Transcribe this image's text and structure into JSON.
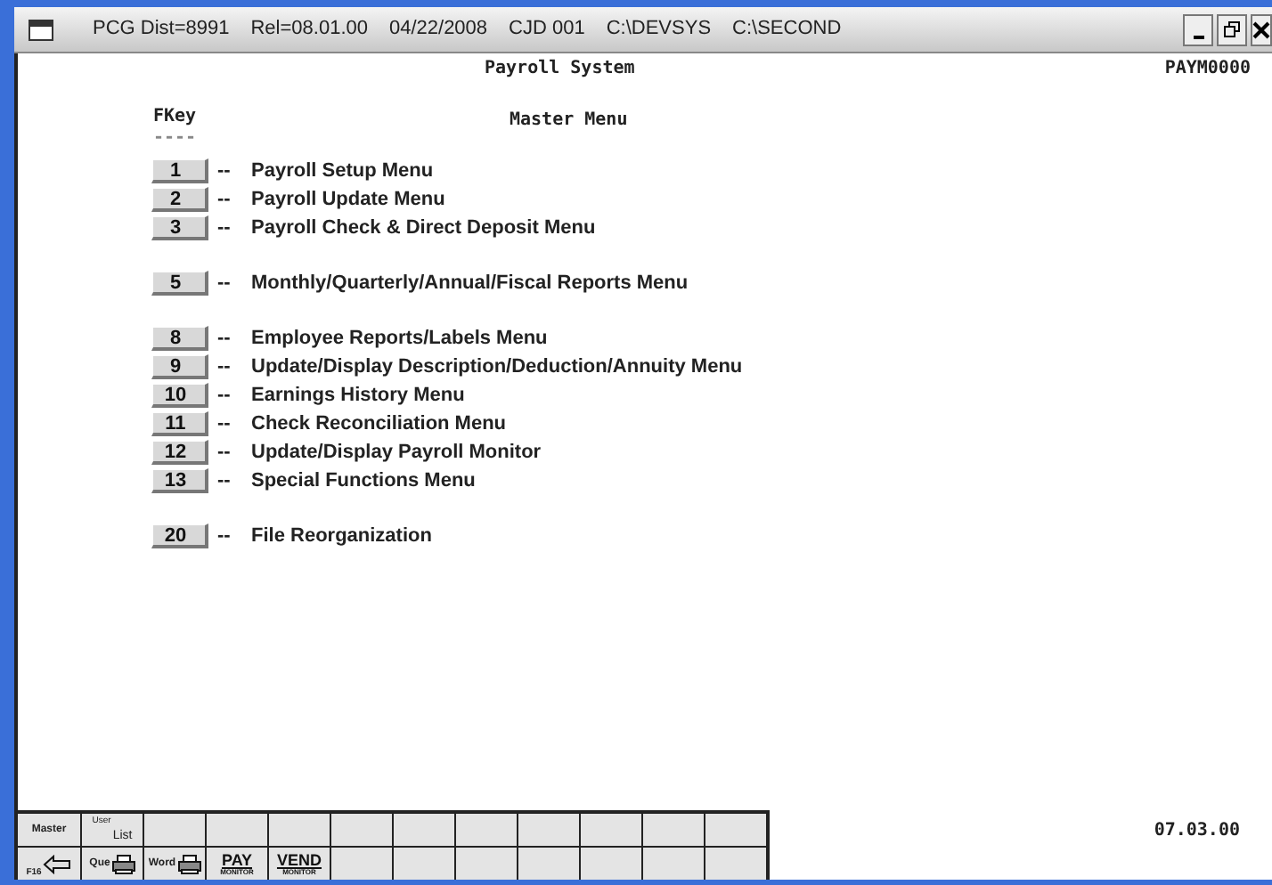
{
  "window": {
    "title_segments": [
      "PCG Dist=8991",
      "Rel=08.01.00",
      "04/22/2008",
      "CJD 001",
      "C:\\DEVSYS",
      "C:\\SECOND"
    ]
  },
  "screen": {
    "title": "Payroll System",
    "code": "PAYM0000",
    "fkey_heading": "FKey",
    "fkey_rule": "----",
    "menu_heading": "Master Menu",
    "version": "07.03.00"
  },
  "menu_groups": [
    [
      {
        "key": "1",
        "label": "Payroll Setup Menu"
      },
      {
        "key": "2",
        "label": "Payroll Update Menu"
      },
      {
        "key": "3",
        "label": "Payroll Check & Direct Deposit Menu"
      }
    ],
    [
      {
        "key": "5",
        "label": "Monthly/Quarterly/Annual/Fiscal Reports Menu"
      }
    ],
    [
      {
        "key": "8",
        "label": "Employee Reports/Labels Menu"
      },
      {
        "key": "9",
        "label": "Update/Display Description/Deduction/Annuity Menu"
      },
      {
        "key": "10",
        "label": "Earnings History Menu"
      },
      {
        "key": "11",
        "label": "Check Reconciliation Menu"
      },
      {
        "key": "12",
        "label": "Update/Display Payroll Monitor"
      },
      {
        "key": "13",
        "label": "Special Functions Menu"
      }
    ],
    [
      {
        "key": "20",
        "label": "File Reorganization"
      }
    ]
  ],
  "menu_separator": "--",
  "toolbar_rows": [
    [
      {
        "kind": "text",
        "text": "Master"
      },
      {
        "kind": "userlist",
        "text": "User",
        "sub": "List"
      },
      {
        "kind": "empty"
      },
      {
        "kind": "empty"
      },
      {
        "kind": "empty"
      },
      {
        "kind": "empty"
      },
      {
        "kind": "empty"
      },
      {
        "kind": "empty"
      },
      {
        "kind": "empty"
      },
      {
        "kind": "empty"
      },
      {
        "kind": "empty"
      },
      {
        "kind": "empty"
      }
    ],
    [
      {
        "kind": "back",
        "text": "F16"
      },
      {
        "kind": "printer",
        "text": "Que"
      },
      {
        "kind": "printer",
        "text": "Word"
      },
      {
        "kind": "monitor",
        "text": "PAY",
        "sub": "MONITOR"
      },
      {
        "kind": "monitor",
        "text": "VEND",
        "sub": "MONITOR"
      },
      {
        "kind": "empty"
      },
      {
        "kind": "empty"
      },
      {
        "kind": "empty"
      },
      {
        "kind": "empty"
      },
      {
        "kind": "empty"
      },
      {
        "kind": "empty"
      },
      {
        "kind": "empty"
      }
    ]
  ]
}
